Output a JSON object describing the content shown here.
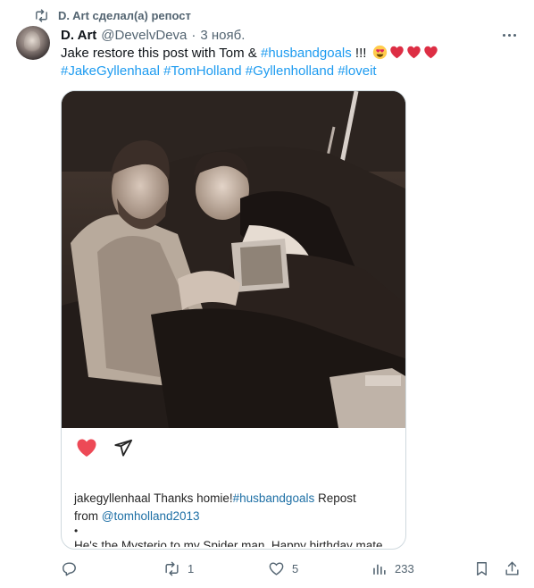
{
  "repost": {
    "label": "D. Art сделал(а) репост",
    "icon": "repost-icon"
  },
  "tweet": {
    "author_name": "D. Art",
    "author_handle": "@DevelvDeva",
    "separator": "·",
    "date": "3 нояб.",
    "text_line1": "Jake restore this post with Tom & ",
    "hashtag1": "#husbandgoals",
    "text_after": " !!! ",
    "hashtags_line2": [
      "#JakeGyllenhaal",
      "#TomHolland",
      "#Gyllenholland",
      "#loveit"
    ],
    "emojis": [
      "heart-eyes-emoji",
      "red-heart-emoji",
      "red-heart-emoji",
      "red-heart-emoji"
    ]
  },
  "embedded_post": {
    "caption_user": "jakegyllenhaal",
    "caption_text": " Thanks homie!",
    "caption_hashtag": "#husbandgoals",
    "caption_repost": "  Repost",
    "caption_from": "from ",
    "caption_mention": "@tomholland2013",
    "bullet": "•",
    "cut_line": "He's the Mysterio to my Spider man. Happy birthday mate",
    "icons": [
      "heart-icon",
      "send-icon"
    ]
  },
  "actions": {
    "reply_count": "",
    "repost_count": "1",
    "like_count": "5",
    "views_count": "233"
  },
  "colors": {
    "link": "#1d9bf0",
    "secondary": "#536471",
    "like_red": "#ed4956"
  }
}
